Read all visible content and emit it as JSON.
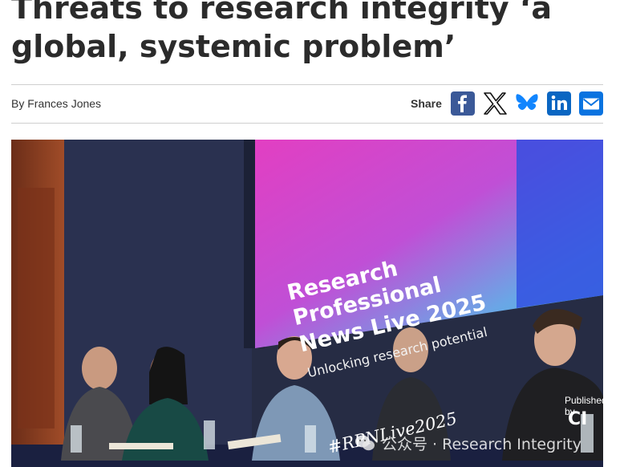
{
  "article": {
    "headline_line1": "Threats to research integrity ‘a",
    "headline_line2": "global, systemic problem’",
    "byline": "By Frances Jones"
  },
  "share": {
    "label": "Share",
    "buttons": [
      {
        "name": "facebook",
        "color": "#3b5998"
      },
      {
        "name": "x",
        "color": "#000000"
      },
      {
        "name": "bluesky",
        "color": "#1185fe"
      },
      {
        "name": "linkedin",
        "color": "#0a66c2"
      },
      {
        "name": "email",
        "color": "#0a73e0"
      }
    ]
  },
  "photo": {
    "screen_line1": "Research",
    "screen_line2": "Professional",
    "screen_line3": "News Live 2025",
    "screen_subtitle": "Unlocking research potential",
    "screen_hashtag": "#RPNLive2025",
    "screen_published": "Published by",
    "screen_brand": "CI"
  },
  "watermark": {
    "text": "公众号 · Research Integrity"
  }
}
